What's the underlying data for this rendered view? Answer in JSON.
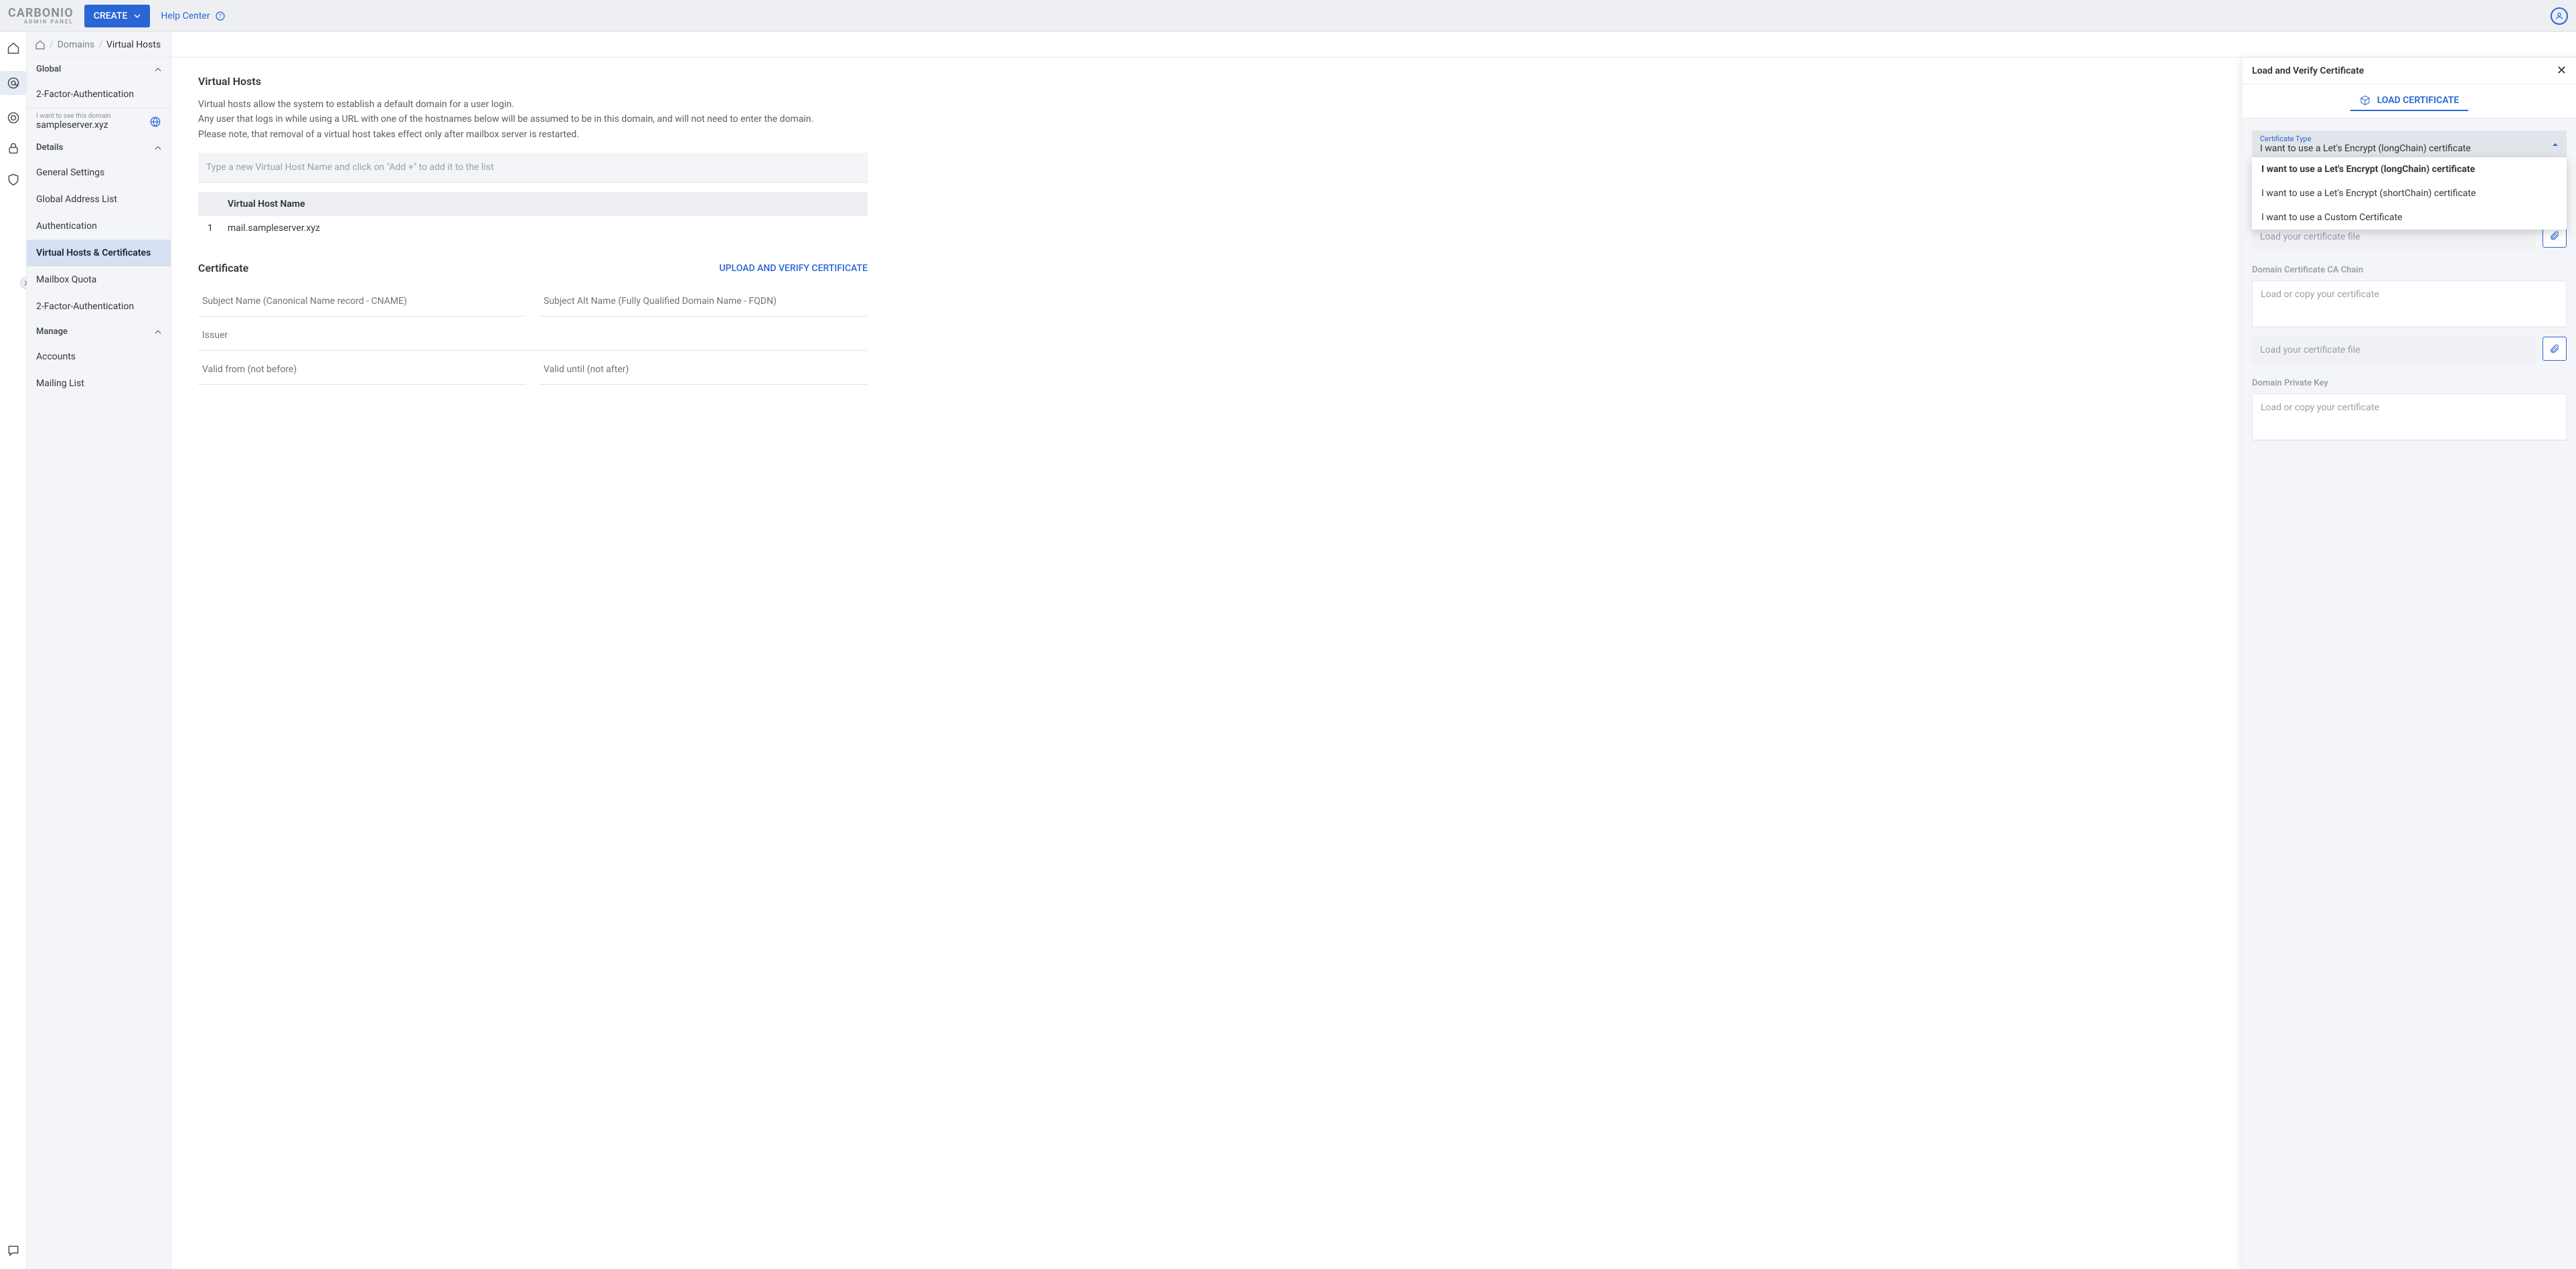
{
  "brand": {
    "line1": "CARBONIO",
    "line2": "ADMIN PANEL"
  },
  "topbar": {
    "create": "CREATE",
    "help": "Help Center"
  },
  "breadcrumbs": {
    "home": "Domains",
    "current": "Virtual Hosts"
  },
  "sidebar": {
    "global": {
      "label": "Global",
      "items": [
        "2-Factor-Authentication"
      ]
    },
    "domain_filter": {
      "hint": "I want to see this domain",
      "value": "sampleserver.xyz"
    },
    "details": {
      "label": "Details",
      "items": [
        "General Settings",
        "Global Address List",
        "Authentication",
        "Virtual Hosts & Certificates",
        "Mailbox Quota",
        "2-Factor-Authentication"
      ]
    },
    "manage": {
      "label": "Manage",
      "items": [
        "Accounts",
        "Mailing List"
      ]
    }
  },
  "main": {
    "vh_title": "Virtual Hosts",
    "vh_desc_l1": "Virtual hosts allow the system to establish a default domain for a user login.",
    "vh_desc_l2": "Any user that logs in while using a URL with one of the hostnames below will be assumed to be in this domain, and will not need to enter the domain.",
    "vh_desc_l3": "Please note, that removal of a virtual host takes effect only after mailbox server is restarted.",
    "vh_input_ph": "Type a new Virtual Host Name and click on \"Add +\" to add it to the list",
    "vh_col": "Virtual Host Name",
    "vh_rows": [
      {
        "idx": "1",
        "name": "mail.sampleserver.xyz"
      }
    ],
    "cert_title": "Certificate",
    "cert_link": "UPLOAD AND VERIFY CERTIFICATE",
    "fields": {
      "subject": "Subject Name (Canonical Name record - CNAME)",
      "san": "Subject Alt Name (Fully Qualified Domain Name - FQDN)",
      "issuer": "Issuer",
      "valid_from": "Valid from (not before)",
      "valid_until": "Valid until (not after)"
    }
  },
  "drawer": {
    "title": "Load and Verify Certificate",
    "tab": "LOAD CERTIFICATE",
    "cert_type_label": "Certificate Type",
    "cert_type_selected": "I want to use a Let's Encrypt (longChain) certificate",
    "cert_type_options": [
      "I want to use a Let's Encrypt (longChain) certificate",
      "I want to use a Let's Encrypt (shortChain) certificate",
      "I want to use a Custom Certificate"
    ],
    "ta_ph": "Load or copy your certificate",
    "file_ph": "Load your certificate file",
    "sec_ca": "Domain Certificate CA Chain",
    "sec_key": "Domain Private Key"
  }
}
